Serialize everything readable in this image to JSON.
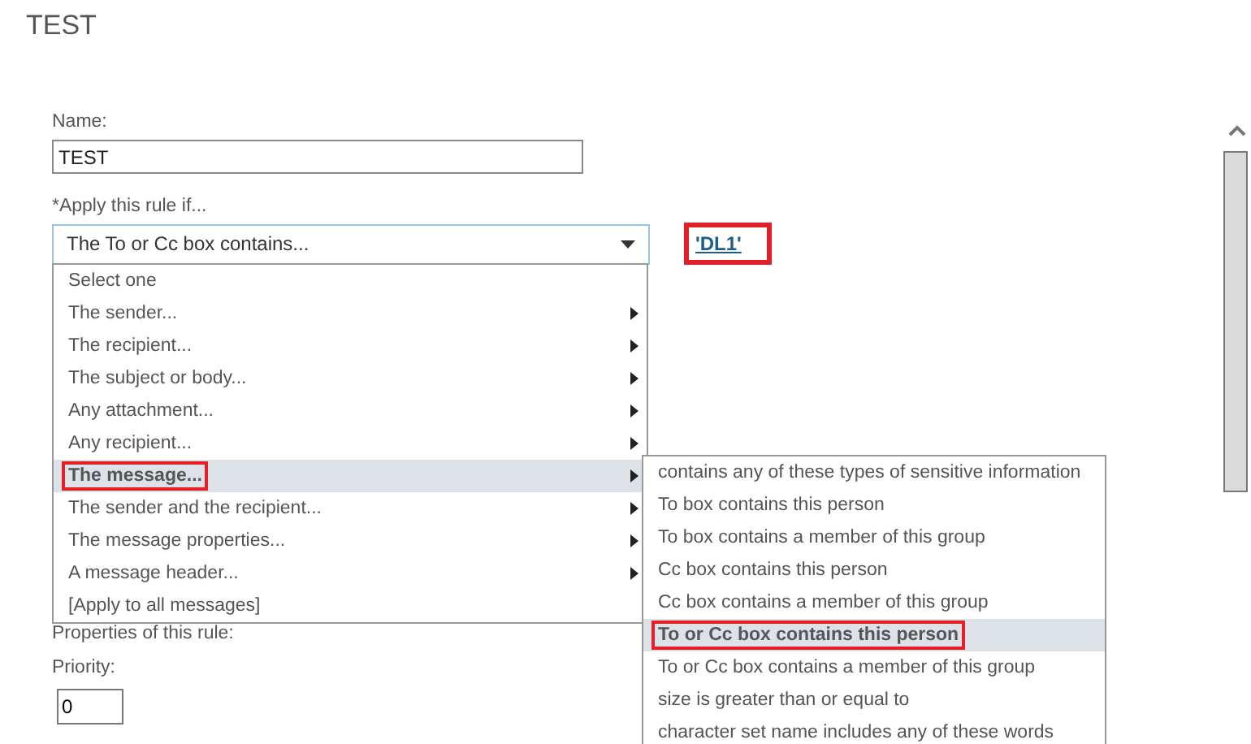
{
  "page_title": "TEST",
  "name_field": {
    "label": "Name:",
    "value": "TEST"
  },
  "condition": {
    "label": "*Apply this rule if...",
    "value": "The To or Cc box contains...",
    "link": {
      "text": "'DL1'",
      "annotated": true
    }
  },
  "menu": [
    {
      "label": "Select one",
      "submenu": false,
      "selected": false,
      "annotated": false
    },
    {
      "label": "The sender...",
      "submenu": true,
      "selected": false,
      "annotated": false
    },
    {
      "label": "The recipient...",
      "submenu": true,
      "selected": false,
      "annotated": false
    },
    {
      "label": "The subject or body...",
      "submenu": true,
      "selected": false,
      "annotated": false
    },
    {
      "label": "Any attachment...",
      "submenu": true,
      "selected": false,
      "annotated": false
    },
    {
      "label": "Any recipient...",
      "submenu": true,
      "selected": false,
      "annotated": false
    },
    {
      "label": "The message...",
      "submenu": true,
      "selected": true,
      "annotated": true
    },
    {
      "label": "The sender and the recipient...",
      "submenu": true,
      "selected": false,
      "annotated": false
    },
    {
      "label": "The message properties...",
      "submenu": true,
      "selected": false,
      "annotated": false
    },
    {
      "label": "A message header...",
      "submenu": true,
      "selected": false,
      "annotated": false
    },
    {
      "label": "[Apply to all messages]",
      "submenu": false,
      "selected": false,
      "annotated": false
    }
  ],
  "submenu": [
    {
      "label": "contains any of these types of sensitive information",
      "selected": false,
      "annotated": false
    },
    {
      "label": "To box contains this person",
      "selected": false,
      "annotated": false
    },
    {
      "label": "To box contains a member of this group",
      "selected": false,
      "annotated": false
    },
    {
      "label": "Cc box contains this person",
      "selected": false,
      "annotated": false
    },
    {
      "label": "Cc box contains a member of this group",
      "selected": false,
      "annotated": false
    },
    {
      "label": "To or Cc box contains this person",
      "selected": true,
      "annotated": true
    },
    {
      "label": "To or Cc box contains a member of this group",
      "selected": false,
      "annotated": false
    },
    {
      "label": "size is greater than or equal to",
      "selected": false,
      "annotated": false
    },
    {
      "label": "character set name includes any of these words",
      "selected": false,
      "annotated": false
    }
  ],
  "properties_label": "Properties of this rule:",
  "priority_field": {
    "label": "Priority:",
    "value": "0"
  }
}
